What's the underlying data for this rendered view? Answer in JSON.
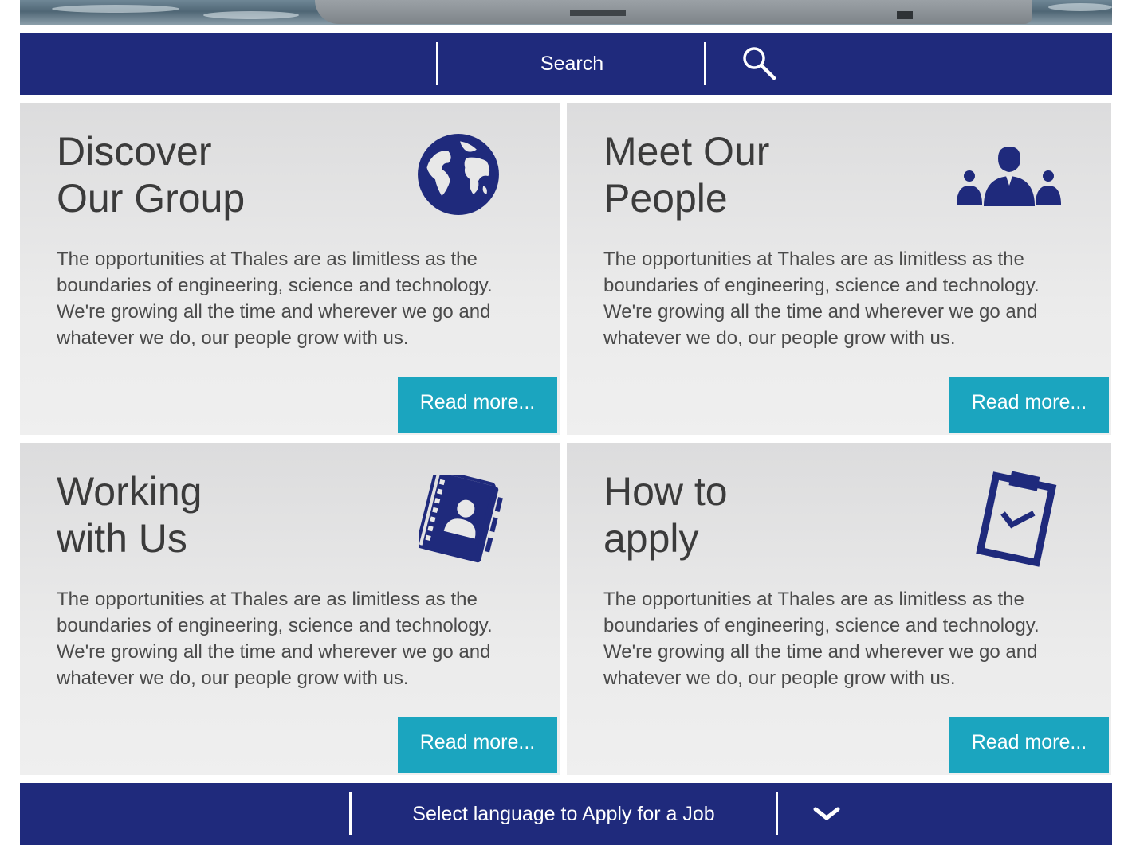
{
  "search": {
    "label": "Search"
  },
  "cards": [
    {
      "title": "Discover\nOur Group",
      "text": "The opportunities at Thales are as limitless as the boundaries of engineering, science and technology. We're growing all the time and wherever we go and whatever we do, our people grow with us.",
      "button": "Read more...",
      "icon": "globe-icon"
    },
    {
      "title": "Meet Our\nPeople",
      "text": "The opportunities at Thales are as limitless as the boundaries of engineering, science and technology. We're growing all the time and wherever we go and whatever we do, our people grow with us.",
      "button": "Read more...",
      "icon": "people-group-icon"
    },
    {
      "title": "Working\nwith Us",
      "text": "The opportunities at Thales are as limitless as the boundaries of engineering, science and technology. We're growing all the time and wherever we go and whatever we do, our people grow with us.",
      "button": "Read more...",
      "icon": "address-book-icon"
    },
    {
      "title": "How to\napply",
      "text": "The opportunities at Thales are as limitless as the boundaries of engineering, science and technology. We're growing all the time and wherever we go and whatever we do, our people grow with us.",
      "button": "Read more...",
      "icon": "clipboard-check-icon"
    }
  ],
  "language": {
    "label": "Select language to Apply for a Job"
  },
  "colors": {
    "brand_navy": "#1f2a7c",
    "accent_teal": "#1ba5bf",
    "card_bg": "#e6e6e6"
  }
}
